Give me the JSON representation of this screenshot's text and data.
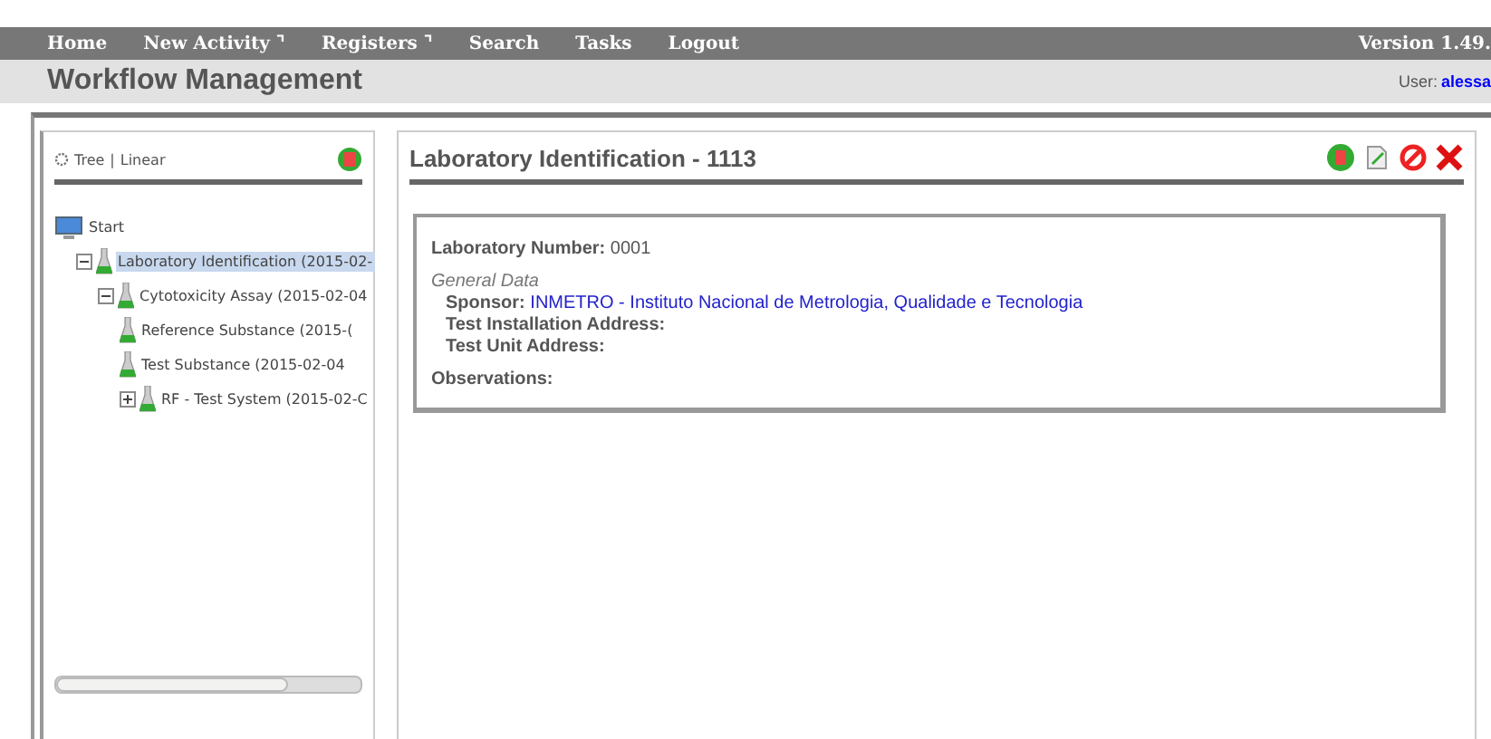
{
  "nav": {
    "items": [
      "Home",
      "New Activity ⌝",
      "Registers ⌝",
      "Search",
      "Tasks",
      "Logout"
    ],
    "version": "Version 1.49."
  },
  "header": {
    "title": "Workflow Management",
    "user_label": "User:",
    "user": "alessa"
  },
  "sidebar": {
    "view_links": [
      "Tree",
      "Linear"
    ],
    "separator": "|",
    "tree": [
      {
        "label": "Start",
        "kind": "root",
        "selected": false,
        "children": [
          {
            "label": "Laboratory Identification (2015-02-",
            "kind": "flask",
            "expanded": true,
            "selected": true,
            "children": [
              {
                "label": "Cytotoxicity Assay (2015-02-04",
                "kind": "flask",
                "expanded": true,
                "selected": false,
                "children": [
                  {
                    "label": "Reference Substance (2015-(",
                    "kind": "flask",
                    "selected": false
                  },
                  {
                    "label": "Test Substance (2015-02-04",
                    "kind": "flask",
                    "selected": false
                  },
                  {
                    "label": "RF - Test System (2015-02-C",
                    "kind": "flask",
                    "expanded": false,
                    "selected": false
                  }
                ]
              }
            ]
          }
        ]
      }
    ]
  },
  "detail": {
    "title": "Laboratory Identification - 1113",
    "number_label": "Laboratory Number:",
    "number": "0001",
    "section": "General Data",
    "fields": [
      {
        "label": "Sponsor:",
        "value": "INMETRO - Instituto Nacional de Metrologia, Qualidade e Tecnologia"
      },
      {
        "label": "Test Installation Address:"
      },
      {
        "label": "Test Unit Address:"
      }
    ],
    "observations_label": "Observations:"
  }
}
